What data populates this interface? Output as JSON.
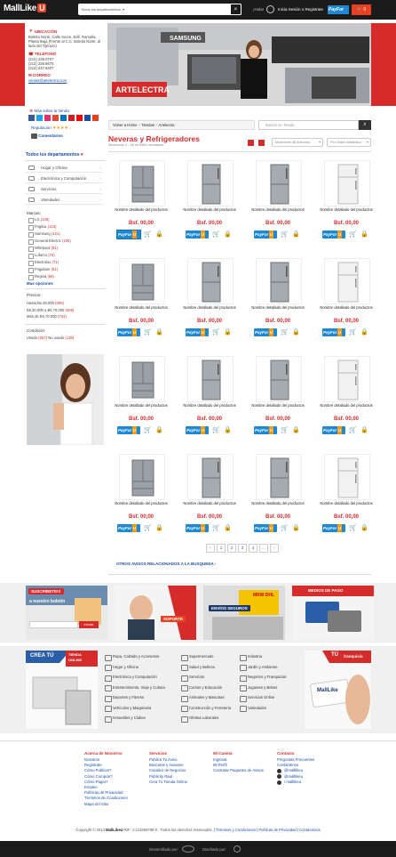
{
  "header": {
    "logo_text": "MallLike",
    "logo_badge": "U",
    "search_dept": "Todos los departamentos",
    "hola": "¡Hola!",
    "login": "Inicia Sesión o Registrate",
    "cart_count": "0"
  },
  "store": {
    "ubicacion_h": "UBICACIÓN",
    "ubicacion_t": "Boleita Norte, Calle Sucre, Edif. Ramolla, Planta Baja (Frente al C.C. Boleita Norte, al lado del Tijerazo)",
    "telefono_h": "TELÉFONO",
    "phones": [
      "(212) 235.0707",
      "(212) 236.8675",
      "(212) 237.6407"
    ],
    "correo_h": "CORREO",
    "email": "ventas@artelectra.com",
    "about": "Más sobre la tienda",
    "reputacion": "Reputación",
    "comentarios": "Comentarios",
    "hero_sign": "ARTELECTRA",
    "hero_brand": "SAMSUNG"
  },
  "sidebar": {
    "dept_title": "Todos los departamentos",
    "depts": [
      "Hogar y Oficina",
      "Electrónica y Computación",
      "Servicios",
      "Variedades"
    ],
    "marcas_h": "Marcas:",
    "marcas": [
      {
        "name": "LG",
        "count": "(136)"
      },
      {
        "name": "Frigilux",
        "count": "(123)"
      },
      {
        "name": "Samsung",
        "count": "(121)"
      },
      {
        "name": "General Electric",
        "count": "(106)"
      },
      {
        "name": "Whirlpool",
        "count": "(81)"
      },
      {
        "name": "Lufurco",
        "count": "(72)"
      },
      {
        "name": "Electrolux",
        "count": "(71)"
      },
      {
        "name": "Frigidaire",
        "count": "(61)"
      },
      {
        "name": "Regina",
        "count": "(58)"
      }
    ],
    "mas_opciones": "Mas opciones",
    "precios_h": "Precios:",
    "precios": [
      {
        "label": "Hasta Bs.30.000",
        "count": "(695)"
      },
      {
        "label": "Bs.30.000 a Bs.70.000",
        "count": "(659)"
      },
      {
        "label": "Más de Bs.70.000",
        "count": "(724)"
      }
    ],
    "condicion_h": "Condición:",
    "usado": "Usado",
    "usado_count": "(657)",
    "nousado": "No usado",
    "nousado_count": "(139)"
  },
  "main": {
    "breadcrumb": [
      "Volver a Home",
      "Tiendas",
      "Artelectra"
    ],
    "search_placeholder": "Buscar en Tienda",
    "title": "Neveras y Refrigeradores",
    "subtitle": "Mostrando 4 - 48 de 5960 resultados",
    "sort1": "Mostrando 48 Artículos",
    "sort2": "Por Orden Alfabético",
    "product_name": "Nombre detallado del productos",
    "product_price": "Bsf. 00,00",
    "pagination": [
      "‹",
      "1",
      "2",
      "3",
      "4",
      "…",
      "›"
    ],
    "related": "OTROS AVISOS RELACIONADOS A LA BUSQUEDA"
  },
  "promos": {
    "suscribete": "SUSCRÍBETE!!!",
    "boletin": "a nuestro boletín",
    "enviar": "enviar",
    "soporte": "SOPORTE",
    "envios": "ENVÍOS SEGUROS",
    "envios_brand": "MRW DHL",
    "medios": "MEDIOS DE PAGO"
  },
  "crea": {
    "line1": "CREA TÚ",
    "line2": "TIENDA",
    "line3": "ONLINE"
  },
  "categories": [
    "Ropa, Calzado y Accesorios",
    "Supermercado",
    "Industria",
    "Hogar y Oficina",
    "Salud y Belleza",
    "Jardín y Ambiente",
    "Electrónica y Computación",
    "Servicios",
    "Negocios y Franquicias",
    "Entretenimiento, Viaje y Cultura",
    "Cursos y Educación",
    "Juguetes y Bebes",
    "Deportes y Fitness",
    "Animales y Mascotas",
    "Servicios Online",
    "Vehículos y Maquinaria",
    "Construcción y Ferretería",
    "Variedades",
    "Inmuebles y Clubes",
    "Ofertas Laborales"
  ],
  "franquicia": {
    "line1": "TÚ",
    "line2": "franquicia",
    "card": "MallLike"
  },
  "footer": {
    "cols": [
      {
        "h": "Acerca de Nosotros",
        "links": [
          "Nosotros",
          "Registrate",
          "Cómo Publicar?",
          "Cómo Comprar?",
          "Cómo Pagar?",
          "Empleo",
          "Políticas de Privacidad",
          "Términos de Condiciones",
          "Mapa del Sitio"
        ]
      },
      {
        "h": "Servicios",
        "links": [
          "Publica Tu Aviso",
          "Búscame y Avisame",
          "Cazador de Negocios",
          "Publicity Raul",
          "Crea Tu Tienda Online"
        ]
      },
      {
        "h": "Mi Cuenta",
        "links": [
          "Ingresar",
          "Mi Perfil",
          "Contratar Paquetes de Avisos"
        ]
      },
      {
        "h": "Contacto",
        "links": [
          "Preguntas Frecuentes",
          "Contáctenos",
          "@malllikeu",
          "@malllikeu",
          "/ malllikeu"
        ]
      }
    ],
    "copy_prefix": "Copyright © 2013",
    "copy_brand": "MallLikeU",
    "copy_rest": "RIF: J-123456789-0 . Todos los derechos reservados.",
    "terms": "Términos y Condiciones",
    "privacy": "Políticas de Privacidad",
    "contact": "Contáctenos",
    "dev_by": "Desarrollado por:",
    "design_by": "Diseñado por:"
  },
  "colors": {
    "accent": "#d62b2b",
    "dark": "#1b1b1b",
    "link": "#1a4ea8",
    "payfor": "#1e88d2"
  }
}
